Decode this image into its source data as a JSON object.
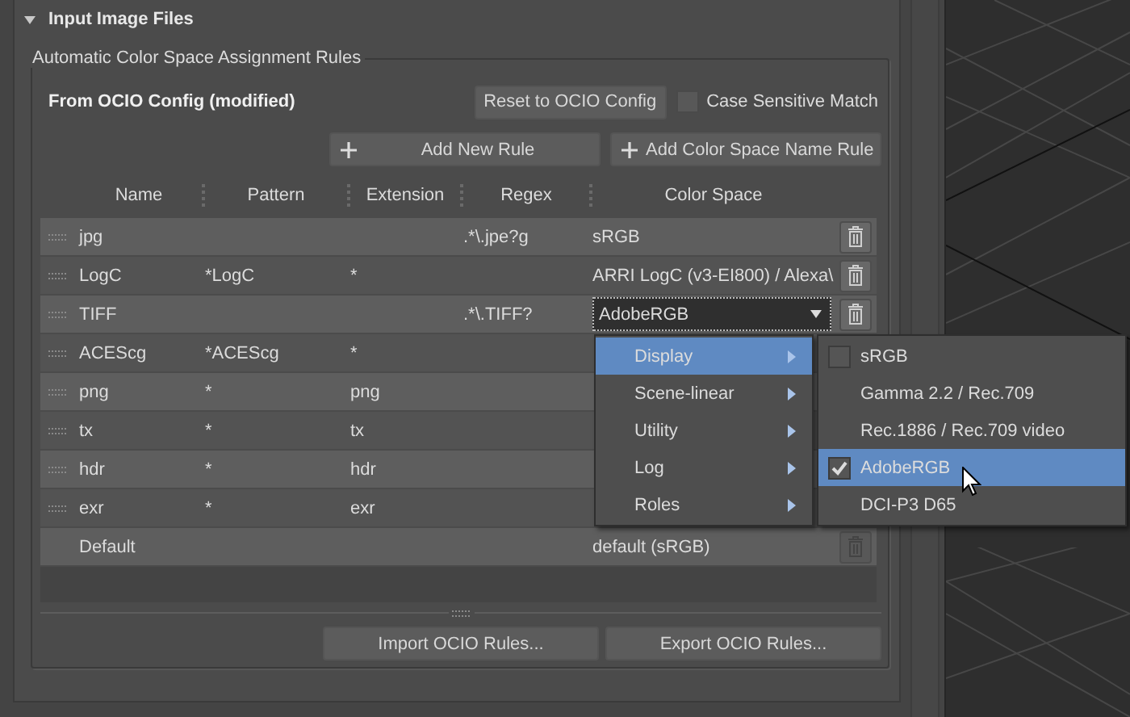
{
  "panel": {
    "title": "Input Image Files",
    "expanded": true
  },
  "group": {
    "title": "Automatic Color Space Assignment Rules",
    "source_label": "From OCIO Config (modified)",
    "reset_button": "Reset to OCIO Config",
    "case_sensitive": {
      "label": "Case Sensitive Match",
      "checked": false
    },
    "add_buttons": [
      "Add New Rule",
      "Add Color Space Name Rule"
    ]
  },
  "table": {
    "columns": [
      "Name",
      "Pattern",
      "Extension",
      "Regex",
      "Color Space"
    ],
    "rows": [
      {
        "kind": "rule",
        "name": "jpg",
        "regex": ".*\\.jpe?g",
        "color_space": "sRGB",
        "delete_disabled": false
      },
      {
        "kind": "rule",
        "name": "LogC",
        "pattern": "*LogC",
        "extension": "*",
        "color_space": "ARRI LogC (v3-EI800) / Alexa\\",
        "delete_disabled": false
      },
      {
        "kind": "editing",
        "name": "TIFF",
        "regex": ".*\\.TIFF?",
        "color_space": "AdobeRGB",
        "delete_disabled": false
      },
      {
        "kind": "rule",
        "name": "ACEScg",
        "pattern": "*ACEScg",
        "extension": "*"
      },
      {
        "kind": "rule",
        "name": "png",
        "pattern": "*",
        "extension": "png"
      },
      {
        "kind": "rule",
        "name": "tx",
        "pattern": "*",
        "extension": "tx"
      },
      {
        "kind": "rule",
        "name": "hdr",
        "pattern": "*",
        "extension": "hdr"
      },
      {
        "kind": "rule",
        "name": "exr",
        "pattern": "*",
        "extension": "exr"
      },
      {
        "kind": "default",
        "name": "Default",
        "color_space": "default (sRGB)",
        "delete_disabled": true
      }
    ]
  },
  "color_menu": {
    "items": [
      {
        "label": "Display",
        "selected": true
      },
      {
        "label": "Scene-linear",
        "selected": false
      },
      {
        "label": "Utility",
        "selected": false
      },
      {
        "label": "Log",
        "selected": false
      },
      {
        "label": "Roles",
        "selected": false
      }
    ],
    "submenu": [
      {
        "kind": "check",
        "label": "sRGB",
        "checked": false,
        "selected": false
      },
      {
        "kind": "plain",
        "label": "Gamma 2.2 / Rec.709",
        "selected": false
      },
      {
        "kind": "plain",
        "label": "Rec.1886 / Rec.709 video",
        "selected": false
      },
      {
        "kind": "check",
        "label": "AdobeRGB",
        "checked": true,
        "selected": true
      },
      {
        "kind": "plain",
        "label": "DCI-P3 D65",
        "selected": false
      }
    ]
  },
  "footer_buttons": [
    "Import OCIO Rules...",
    "Export OCIO Rules..."
  ]
}
